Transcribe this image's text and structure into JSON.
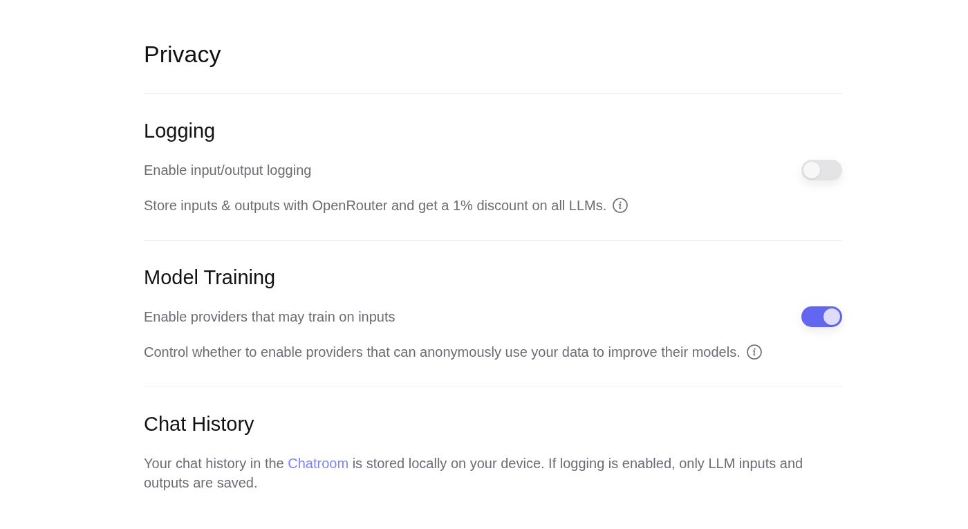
{
  "page": {
    "title": "Privacy"
  },
  "sections": [
    {
      "kind": "toggle",
      "heading": "Logging",
      "setting": {
        "label": "Enable input/output logging",
        "on": false
      },
      "description": "Store inputs & outputs with OpenRouter and get a 1% discount on all LLMs.",
      "info_icon": true
    },
    {
      "kind": "toggle",
      "heading": "Model Training",
      "setting": {
        "label": "Enable providers that may train on inputs",
        "on": true
      },
      "description": "Control whether to enable providers that can anonymously use your data to improve their models.",
      "info_icon": true
    },
    {
      "kind": "text",
      "heading": "Chat History",
      "paragraph": [
        {
          "kind": "text",
          "text": "Your chat history in the "
        },
        {
          "kind": "link",
          "text": "Chatroom"
        },
        {
          "kind": "text",
          "text": " is stored locally on your device. If logging is enabled, only LLM inputs and outputs are saved."
        }
      ]
    }
  ]
}
